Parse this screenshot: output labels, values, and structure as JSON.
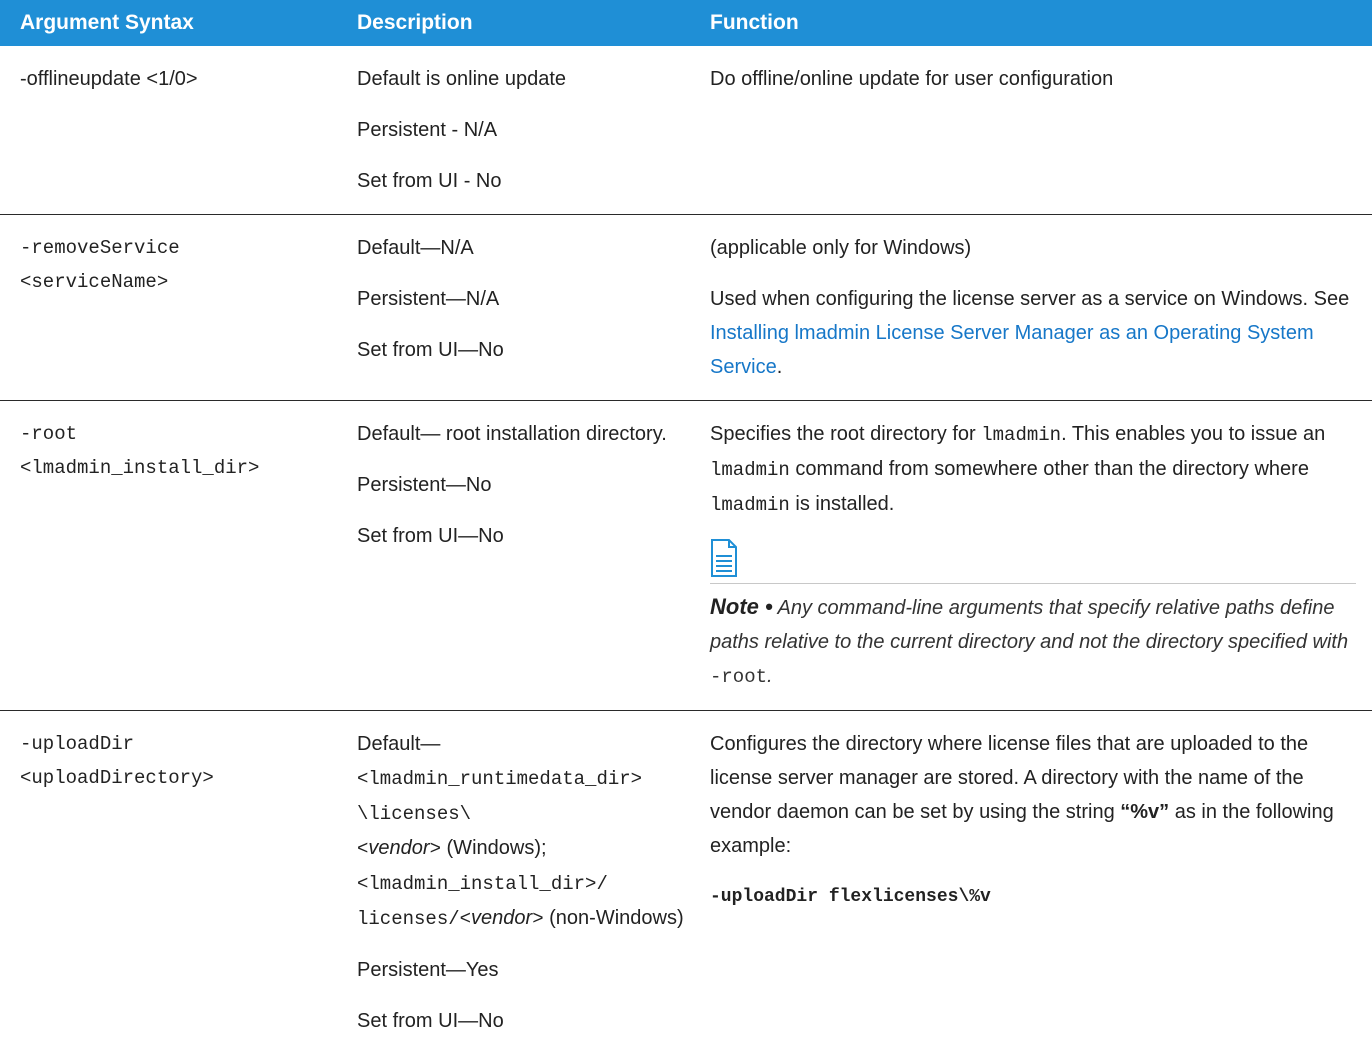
{
  "colors": {
    "header_bg": "#1f8fd6",
    "link": "#1677c8"
  },
  "headers": [
    "Argument Syntax",
    "Description",
    "Function"
  ],
  "row1": {
    "arg": "-offlineupdate <1/0>",
    "desc": [
      "Default is online update",
      "Persistent - N/A",
      "Set from UI - No"
    ],
    "func": "Do offline/online update for user configuration"
  },
  "row2": {
    "arg_l1": "-removeService",
    "arg_l2": "<serviceName>",
    "desc": [
      "Default—N/A",
      "Persistent—N/A",
      "Set from UI—No"
    ],
    "func_p1": "(applicable only for Windows)",
    "func_p2_a": "Used when configuring the license server as a service on Windows. See ",
    "func_p2_link": "Installing lmadmin License Server Manager as an Operating System Service",
    "func_p2_b": "."
  },
  "row3": {
    "arg_l1": "-root",
    "arg_l2": "<lmadmin_install_dir>",
    "desc": [
      "Default— root installation directory.",
      "Persistent—No",
      "Set from UI—No"
    ],
    "func_a": "Specifies the root directory for ",
    "func_code1": "lmadmin",
    "func_b": ". This enables you to issue an ",
    "func_code2": "lmadmin",
    "func_c": " command from somewhere other than the directory where ",
    "func_code3": "lmadmin",
    "func_d": " is installed.",
    "note_icon": "document-icon",
    "note_label": "Note •",
    "note_text": " Any command-line arguments that specify relative paths define paths relative to the current directory and not the directory specified with ",
    "note_code": "-root",
    "note_end": "."
  },
  "row4": {
    "arg_l1": "-uploadDir",
    "arg_l2": "<uploadDirectory>",
    "desc_default": "Default—",
    "desc_code1": "<lmadmin_runtimedata_dir>",
    "desc_code2": "\\licenses\\",
    "desc_code3_a": "<",
    "desc_vendor": "vendor",
    "desc_code3_b": ">",
    "desc_win": " (Windows);",
    "desc_code4": "<lmadmin_install_dir>/",
    "desc_code5": "licenses/<",
    "desc_vendor2": "vendor",
    "desc_code5_b": ">",
    "desc_nonwin": " (non-Windows)",
    "desc_p2": "Persistent—Yes",
    "desc_p3": "Set from UI—No",
    "func_a": "Configures the directory where license files that are uploaded to the license server manager are stored. A directory with the name of the vendor daemon can be set by using the string ",
    "func_bold": "“%v”",
    "func_b": " as in the following example:",
    "cmd": "-uploadDir flexlicenses\\%v"
  }
}
